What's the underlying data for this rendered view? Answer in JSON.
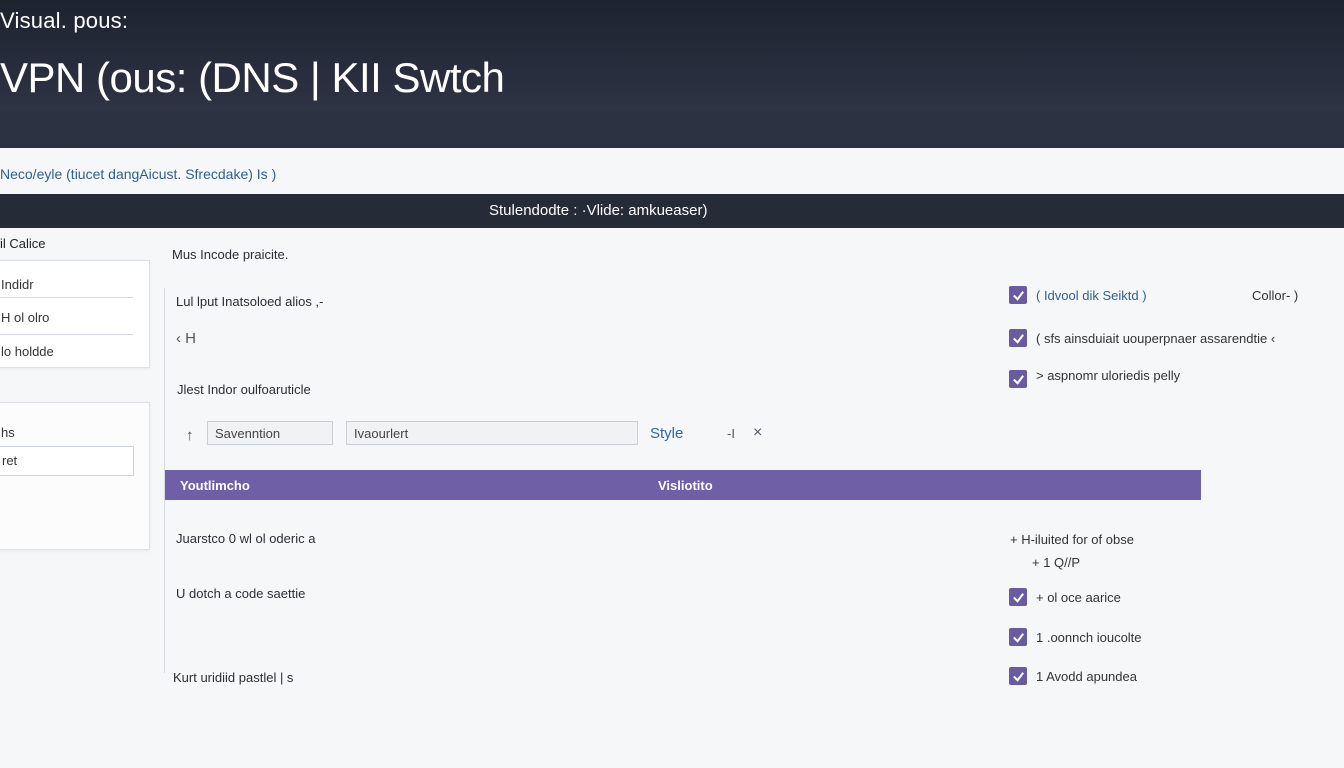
{
  "header": {
    "kicker": "Visual. pous:",
    "title": "VPN (ous: (DNS | KII Swtch"
  },
  "subline": "Neco/eyle (tiucet dangAicust. Sfrecdake) Is )",
  "status_bar": "Stulendodte : ·Vlide: amkueaser)",
  "left_panel": {
    "heading": "il Calice",
    "card1_items": [
      "Indidr",
      "H ol olro",
      "lo holdde"
    ],
    "card2_label": "hs",
    "card2_input_value": "ret"
  },
  "main": {
    "line1": "Mus Incode praicite.",
    "line2": "Lul lput Inatsoloed alios ,-",
    "back_label": "‹ H",
    "line3": "Jlest Indor oulfoaruticle",
    "field1_value": "Savenntion",
    "field2_value": "Ivaourlert",
    "style_link": "Style",
    "mini_control": "-I",
    "close_symbol": "×",
    "table_header": [
      "Youtlimcho",
      "Visliotito"
    ],
    "row1": "Juarstco 0 wl ol oderic a",
    "row2": "U dotch a code saettie",
    "row3": "Kurt uridiid pastlel | s"
  },
  "options_top": [
    {
      "label": "( Idvool dik Seiktd )",
      "checked": true
    },
    {
      "label": "( sfs ainsduiait uouperpnaer assarendtie ‹",
      "checked": true
    },
    {
      "label": "> aspnomr uloriedis pelly",
      "checked": true
    }
  ],
  "color_label": "Collor- )",
  "notes": [
    "+ H-iluited for of obse",
    "+ 1 Q//P"
  ],
  "options_bottom": [
    {
      "label": "+ ol oce aarice",
      "checked": true
    },
    {
      "label": "1 .oonnch ioucolte",
      "checked": true
    },
    {
      "label": "1 Avodd apundea",
      "checked": true
    }
  ],
  "colors": {
    "accent": "#6f5fa6",
    "header_bg": "#262b38",
    "link": "#2e6aa2"
  }
}
